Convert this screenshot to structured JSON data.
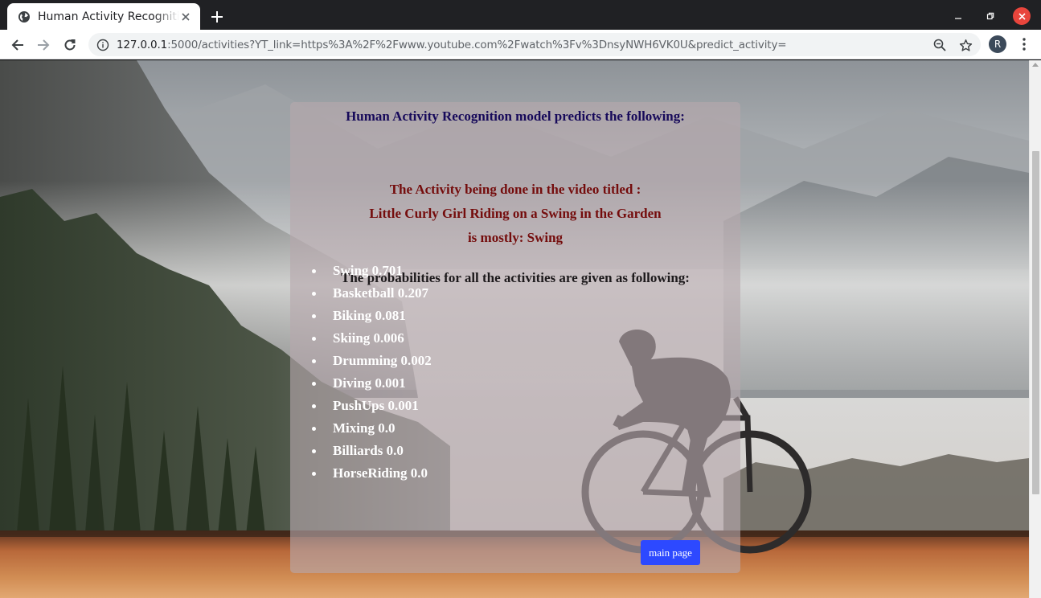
{
  "browser": {
    "tab_title": "Human Activity Recognition",
    "url_host": "127.0.0.1",
    "url_rest": ":5000/activities?YT_link=https%3A%2F%2Fwww.youtube.com%2Fwatch%3Fv%3DnsyNWH6VK0U&predict_activity=",
    "profile_initial": "R"
  },
  "page": {
    "heading": "Human Activity Recognition model predicts the following:",
    "result_intro": "The Activity being done in the video titled :",
    "video_title": "Little Curly Girl Riding on a Swing in the Garden",
    "result_summary": "is mostly: Swing",
    "prob_heading": "The probabilities for all the activities are given as following:",
    "probabilities": [
      {
        "label": "Swing 0.701"
      },
      {
        "label": "Basketball 0.207"
      },
      {
        "label": "Biking 0.081"
      },
      {
        "label": "Skiing 0.006"
      },
      {
        "label": "Drumming 0.002"
      },
      {
        "label": "Diving 0.001"
      },
      {
        "label": "PushUps 0.001"
      },
      {
        "label": "Mixing 0.0"
      },
      {
        "label": "Billiards 0.0"
      },
      {
        "label": "HorseRiding 0.0"
      }
    ],
    "main_page_button": "main page"
  },
  "colors": {
    "heading": "#170a5a",
    "result": "#740c0c",
    "button": "#2d49ff"
  }
}
